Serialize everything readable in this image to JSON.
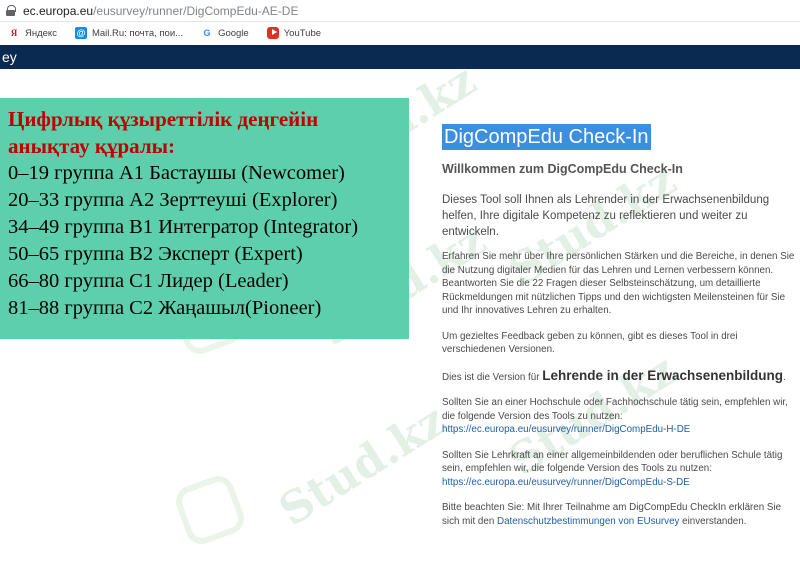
{
  "browser": {
    "url_host": "ec.europa.eu",
    "url_path": "/eusurvey/runner/DigCompEdu-AE-DE",
    "bookmarks": [
      {
        "label": "Яндекс",
        "icon": "yandex-icon"
      },
      {
        "label": "Mail.Ru: почта, пои...",
        "icon": "mail-ru-icon"
      },
      {
        "label": "Google",
        "icon": "google-icon"
      },
      {
        "label": "YouTube",
        "icon": "youtube-icon"
      }
    ]
  },
  "site": {
    "header_text": "ey"
  },
  "levels": {
    "title": "Цифрлық құзыреттілік деңгейін анықтау құралы:",
    "items": [
      "0–19 группа А1 Бастаушы (Newcomer)",
      "20–33 группа А2 Зерттеуші (Explorer)",
      "34–49 группа В1 Интегратор (Integrator)",
      "50–65 группа В2 Эксперт (Expert)",
      "66–80 группа С1 Лидер (Leader)",
      "81–88 группа С2 Жаңашыл(Pioneer)"
    ]
  },
  "survey": {
    "title": "DigCompEdu Check-In",
    "subtitle": "Willkommen zum DigCompEdu Check-In",
    "intro": "Dieses Tool soll Ihnen als Lehrender in der Erwachsenenbildung helfen, Ihre digitale Kompetenz zu reflektieren und weiter zu entwickeln.",
    "p1": "Erfahren Sie mehr über Ihre persönlichen Stärken und die Bereiche, in denen Sie die Nutzung digitaler Medien für das Lehren und Lernen verbessern können. Beantworten Sie die 22 Fragen dieser Selbsteinschätzung, um detaillierte Rückmeldungen mit nützlichen Tipps und den wichtigsten Meilensteinen für Sie und Ihr innovatives Lehren zu erhalten.",
    "p2": "Um gezieltes Feedback geben zu können, gibt es dieses Tool in drei verschiedenen Versionen.",
    "p3_prefix": "Dies ist die Version für ",
    "p3_bold": "Lehrende in der Erwachsenenbildung",
    "p3_suffix": ".",
    "p4": "Sollten Sie an einer Hochschule oder Fachhochschule  tätig sein, empfehlen wir, die folgende Version des Tools zu nutzen:",
    "p4_link": "https://ec.europa.eu/eusurvey/runner/DigCompEdu-H-DE",
    "p5": "Sollten Sie Lehrkraft an einer allgemeinbildenden oder beruflichen Schule tätig sein, empfehlen wir, die folgende Version des Tools zu nutzen:",
    "p5_link": "https://ec.europa.eu/eusurvey/runner/DigCompEdu-S-DE",
    "p6_prefix": "Bitte beachten Sie: Mit Ihrer Teilnahme am DigCompEdu CheckIn erklären Sie sich mit den ",
    "p6_link": "Datenschutzbestimmungen von EUsurvey",
    "p6_suffix": " einverstanden."
  },
  "watermark": {
    "text": "Stud.kz"
  }
}
